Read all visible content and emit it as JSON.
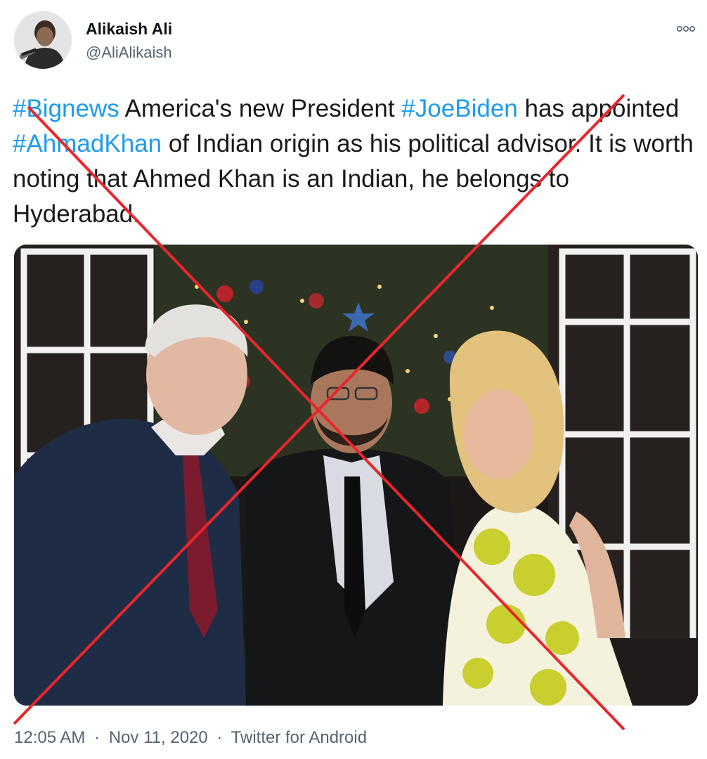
{
  "tweet": {
    "author": {
      "display_name": "Alikaish Ali",
      "handle": "@AliAlikaish",
      "avatar_icon": "user-avatar"
    },
    "more_icon": "more-options-icon",
    "text_segments": [
      {
        "type": "hashtag",
        "text": "#Bignews"
      },
      {
        "type": "text",
        "text": " America's new President "
      },
      {
        "type": "hashtag",
        "text": "#JoeBiden"
      },
      {
        "type": "text",
        "text": " has appointed "
      },
      {
        "type": "hashtag",
        "text": "#AhmadKhan"
      },
      {
        "type": "text",
        "text": " of Indian origin as his political advisor. It is worth noting that Ahmed Khan is an Indian, he belongs to Hyderabad."
      }
    ],
    "time": "12:05 AM",
    "date": "Nov 11, 2020",
    "source": "Twitter for Android",
    "separator": "·"
  },
  "overlay": {
    "cross_color": "#e8262c"
  },
  "colors": {
    "link": "#1d9bf0",
    "secondary_text": "#536471",
    "primary_text": "#0f1419"
  }
}
